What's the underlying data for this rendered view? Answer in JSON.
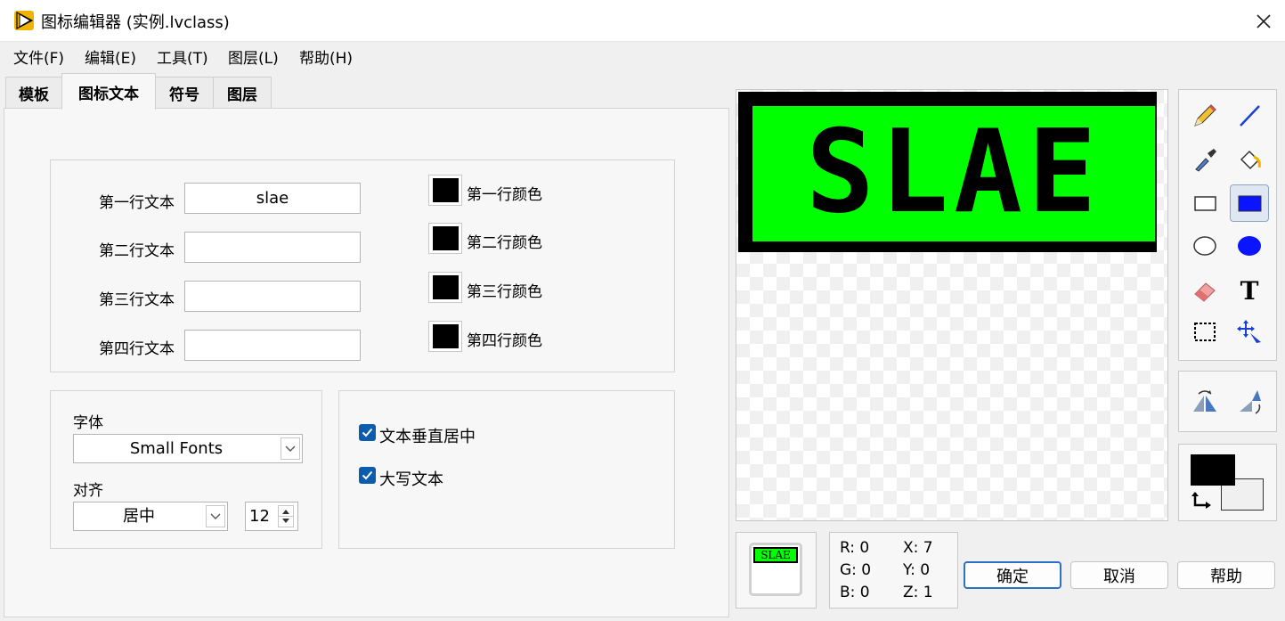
{
  "window": {
    "title": "图标编辑器 (实例.lvclass)"
  },
  "menu": [
    "文件(F)",
    "编辑(E)",
    "工具(T)",
    "图层(L)",
    "帮助(H)"
  ],
  "tabs": [
    {
      "label": "模板",
      "active": false
    },
    {
      "label": "图标文本",
      "active": true
    },
    {
      "label": "符号",
      "active": false
    },
    {
      "label": "图层",
      "active": false
    }
  ],
  "text_lines": [
    {
      "label": "第一行文本",
      "value": "slae",
      "color_label": "第一行颜色",
      "color": "#000000"
    },
    {
      "label": "第二行文本",
      "value": "",
      "color_label": "第二行颜色",
      "color": "#000000"
    },
    {
      "label": "第三行文本",
      "value": "",
      "color_label": "第三行颜色",
      "color": "#000000"
    },
    {
      "label": "第四行文本",
      "value": "",
      "color_label": "第四行颜色",
      "color": "#000000"
    }
  ],
  "font": {
    "label": "字体",
    "value": "Small Fonts"
  },
  "align": {
    "label": "对齐",
    "value": "居中",
    "size": "12"
  },
  "options": [
    {
      "label": "文本垂直居中",
      "checked": true
    },
    {
      "label": "大写文本",
      "checked": true
    }
  ],
  "canvas": {
    "icon_text": "SLAE",
    "background_color": "#00ff00",
    "border_color": "#000000",
    "text_color": "#000000"
  },
  "tools": [
    "pencil-icon",
    "line-icon",
    "dropper-icon",
    "fill-bucket-icon",
    "rectangle-icon",
    "filled-rectangle-icon",
    "ellipse-icon",
    "filled-ellipse-icon",
    "eraser-icon",
    "text-tool-icon",
    "select-icon",
    "move-icon"
  ],
  "selected_tool": "filled-rectangle-icon",
  "flip_tools": [
    "flip-horizontal-icon",
    "flip-vertical-icon"
  ],
  "colors": {
    "foreground": "#000000",
    "background": "#f0f0f0"
  },
  "preview": {
    "text": "SLAE"
  },
  "coords": {
    "r": "R: 0",
    "g": "G: 0",
    "b": "B: 0",
    "x": "X: 7",
    "y": "Y: 0",
    "z": "Z: 1"
  },
  "buttons": {
    "ok": "确定",
    "cancel": "取消",
    "help": "帮助"
  }
}
